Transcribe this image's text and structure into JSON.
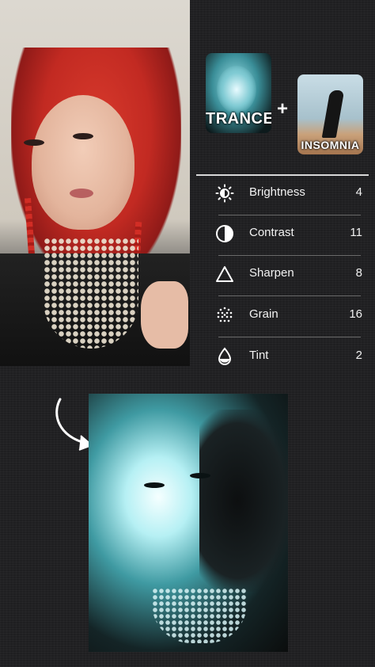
{
  "presets": [
    {
      "name": "TRANCE"
    },
    {
      "name": "INSOMNIA"
    }
  ],
  "plus_symbol": "+",
  "adjustments": [
    {
      "label": "Brightness",
      "value": "4",
      "icon": "brightness-icon"
    },
    {
      "label": "Contrast",
      "value": "11",
      "icon": "contrast-icon"
    },
    {
      "label": "Sharpen",
      "value": "8",
      "icon": "sharpen-icon"
    },
    {
      "label": "Grain",
      "value": "16",
      "icon": "grain-icon"
    },
    {
      "label": "Tint",
      "value": "2",
      "icon": "tint-icon"
    }
  ],
  "colors": {
    "background": "#1d1d1f",
    "text": "#f2f2f2",
    "accent_cyan": "#7fcad3",
    "hair_red": "#d83a2c"
  }
}
